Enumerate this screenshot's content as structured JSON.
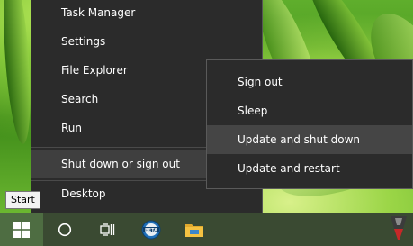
{
  "tooltip": "Start",
  "main_menu": {
    "items": [
      {
        "label": "Task Manager"
      },
      {
        "label": "Settings"
      },
      {
        "label": "File Explorer"
      },
      {
        "label": "Search"
      },
      {
        "label": "Run"
      },
      {
        "label": "Shut down or sign out"
      },
      {
        "label": "Desktop"
      }
    ]
  },
  "shutdown_submenu": {
    "items": [
      {
        "label": "Sign out"
      },
      {
        "label": "Sleep"
      },
      {
        "label": "Update and shut down"
      },
      {
        "label": "Update and restart"
      }
    ]
  },
  "taskbar": {
    "icons": [
      "windows-start-icon",
      "search-circle-icon",
      "task-view-icon",
      "beta-app-icon",
      "file-explorer-icon"
    ],
    "beta_badge": "BETA"
  },
  "colors": {
    "menu_bg": "#2b2b2b",
    "highlight": "#3f3f3f",
    "taskbar": "#3a4a32",
    "start_button": "#4e6d42",
    "explorer_folder": "#f5c242"
  }
}
